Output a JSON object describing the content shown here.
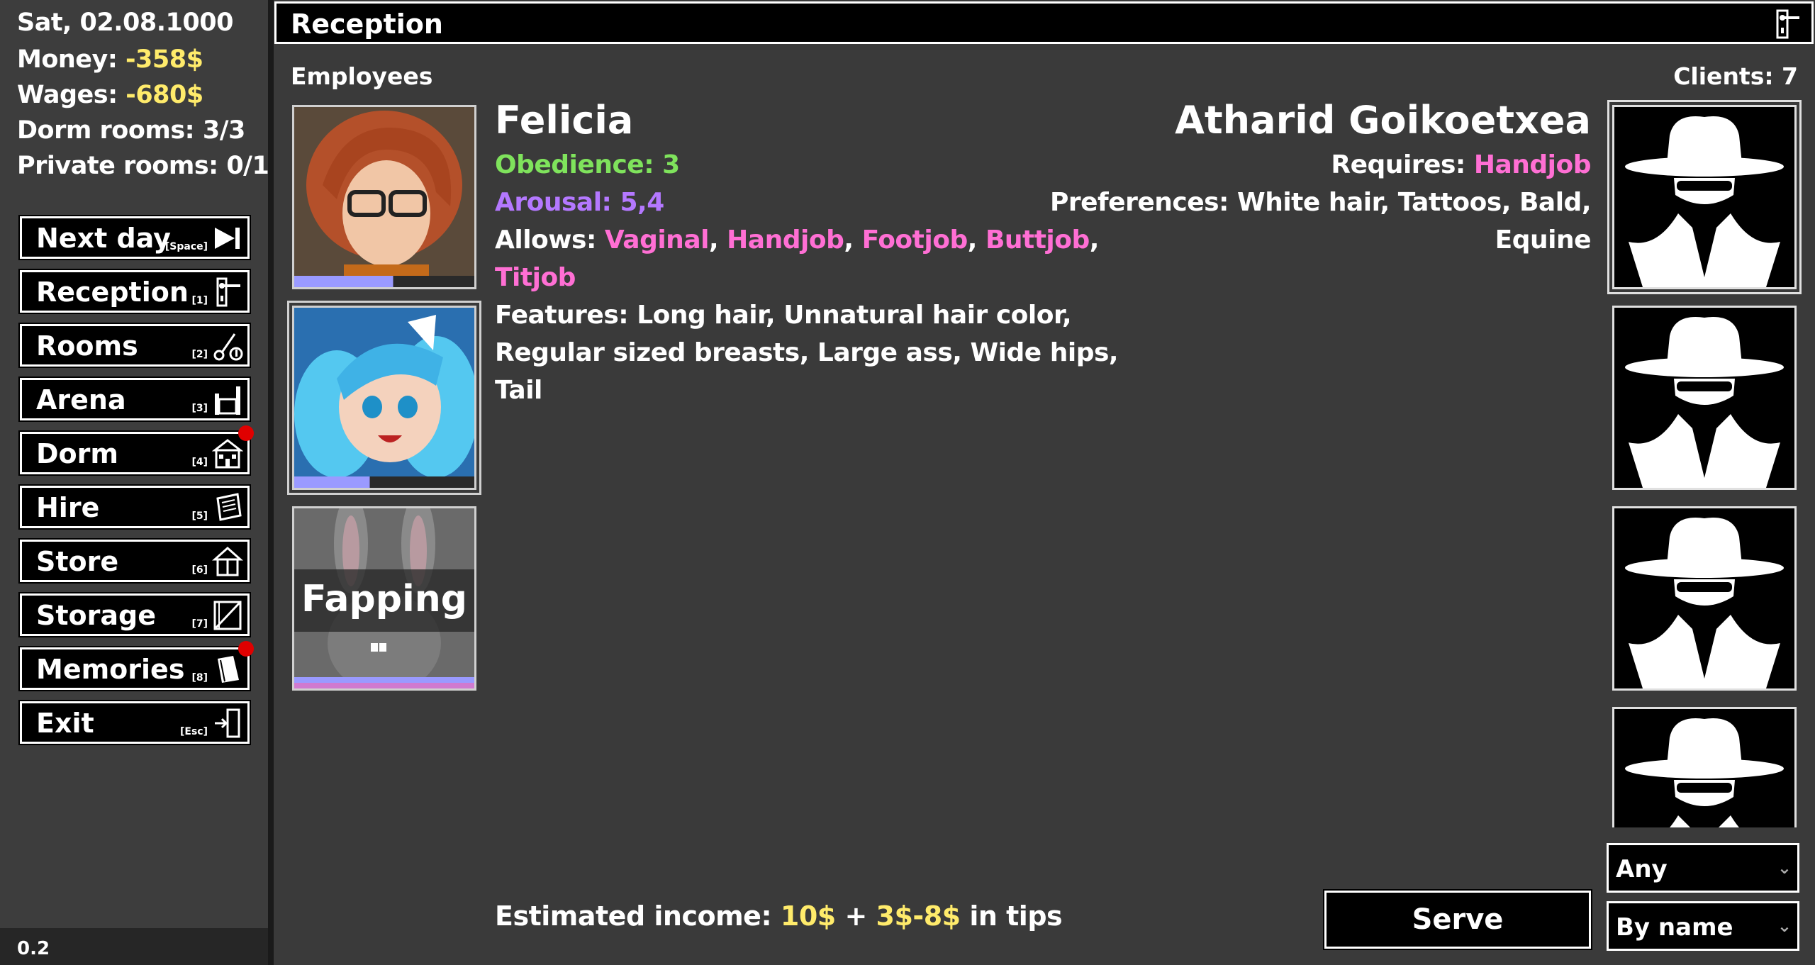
{
  "sidebar": {
    "date": "Sat, 02.08.1000",
    "money_label": "Money: ",
    "money_value": "-358$",
    "wages_label": "Wages: ",
    "wages_value": "-680$",
    "dorm_rooms": "Dorm rooms: 3/3",
    "private_rooms": "Private rooms: 0/1",
    "nav": [
      {
        "label": "Next day",
        "key": "[Space]",
        "icon": "skip-forward-icon"
      },
      {
        "label": "Reception",
        "key": "[1]",
        "icon": "door-handle-icon"
      },
      {
        "label": "Rooms",
        "key": "[2]",
        "icon": "key-icon"
      },
      {
        "label": "Arena",
        "key": "[3]",
        "icon": "arena-icon"
      },
      {
        "label": "Dorm",
        "key": "[4]",
        "icon": "house-icon",
        "notification": true
      },
      {
        "label": "Hire",
        "key": "[5]",
        "icon": "contract-icon"
      },
      {
        "label": "Store",
        "key": "[6]",
        "icon": "store-tent-icon"
      },
      {
        "label": "Storage",
        "key": "[7]",
        "icon": "crate-icon"
      },
      {
        "label": "Memories",
        "key": "[8]",
        "icon": "book-icon",
        "notification": true
      },
      {
        "label": "Exit",
        "key": "[Esc]",
        "icon": "exit-door-icon"
      }
    ],
    "version": "0.2"
  },
  "header": {
    "title": "Reception",
    "icon": "door-handle-icon"
  },
  "employees_label": "Employees",
  "clients_label": "Clients: 7",
  "employees": [
    {
      "name": "Felicia",
      "selected": false,
      "status": ""
    },
    {
      "name": "",
      "selected": true,
      "status": ""
    },
    {
      "name": "",
      "selected": false,
      "status": "Fapping"
    }
  ],
  "selected_employee": {
    "name": "Felicia",
    "obedience_label": "Obedience: 3",
    "arousal_label": "Arousal: 5,4",
    "allows_label": "Allows: ",
    "allows": [
      "Vaginal",
      "Handjob",
      "Footjob",
      "Buttjob",
      "Titjob"
    ],
    "features_line1": "Features: Long hair, Unnatural hair color,",
    "features_line2": "Regular sized breasts, Large ass, Wide hips,",
    "features_line3": "Tail"
  },
  "selected_client": {
    "name": "Atharid Goikoetxea",
    "requires_label": "Requires: ",
    "requires": "Handjob",
    "preferences_line1": "Preferences: White hair, Tattoos, Bald,",
    "preferences_line2": "Equine"
  },
  "client_cards": [
    {
      "icon": "spy-silhouette-icon",
      "selected": true
    },
    {
      "icon": "spy-silhouette-icon",
      "selected": false
    },
    {
      "icon": "spy-silhouette-icon",
      "selected": false
    },
    {
      "icon": "spy-silhouette-icon",
      "selected": false
    }
  ],
  "income": {
    "label": "Estimated income: ",
    "base": "10$",
    "plus": " + ",
    "tips_min": "3$",
    "dash": "-",
    "tips_max": "8$",
    "suffix": " in tips"
  },
  "serve_label": "Serve",
  "filter_select": "Any",
  "sort_select": "By name",
  "colors": {
    "background": "#3a3a3a",
    "money_yellow": "#ffeb6b",
    "obedience_green": "#7fe35c",
    "arousal_purple": "#b478ff",
    "act_pink": "#ff6fd4",
    "notification_red": "#e00000"
  }
}
